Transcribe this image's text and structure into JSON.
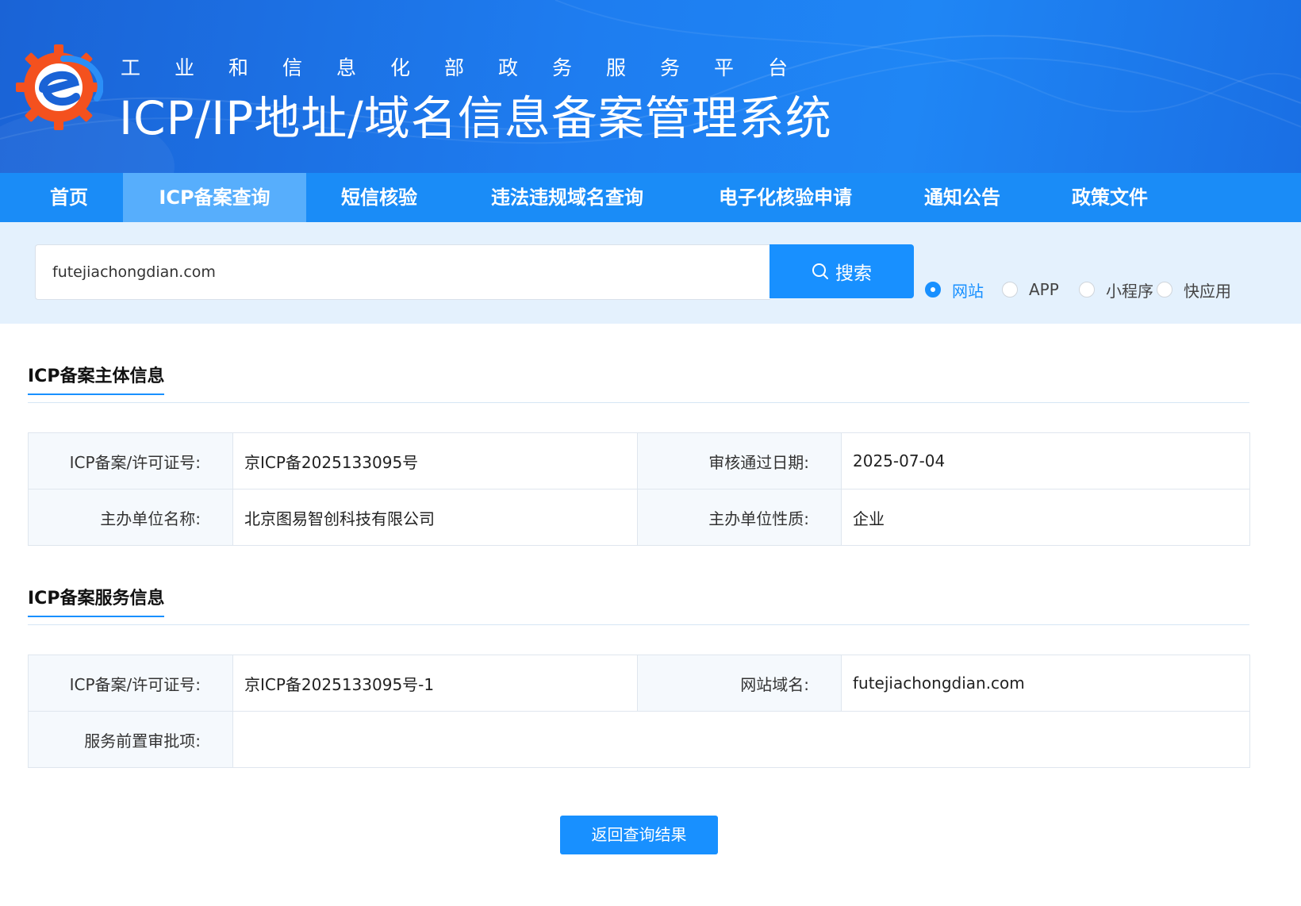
{
  "header": {
    "subtitle": "工业和信息化部政务服务平台",
    "title": "ICP/IP地址/域名信息备案管理系统"
  },
  "nav": {
    "items": [
      {
        "label": "首页"
      },
      {
        "label": "ICP备案查询",
        "active": true
      },
      {
        "label": "短信核验"
      },
      {
        "label": "违法违规域名查询"
      },
      {
        "label": "电子化核验申请"
      },
      {
        "label": "通知公告"
      },
      {
        "label": "政策文件"
      }
    ]
  },
  "search": {
    "value": "futejiachongdian.com",
    "button_label": "搜索",
    "types": [
      {
        "label": "网站",
        "checked": true
      },
      {
        "label": "APP",
        "checked": false
      },
      {
        "label": "小程序",
        "checked": false
      },
      {
        "label": "快应用",
        "checked": false
      }
    ]
  },
  "subject_info": {
    "title": "ICP备案主体信息",
    "license_label": "ICP备案/许可证号:",
    "license_value": "京ICP备2025133095号",
    "approval_date_label": "审核通过日期:",
    "approval_date_value": "2025-07-04",
    "organizer_label": "主办单位名称:",
    "organizer_value": "北京图易智创科技有限公司",
    "nature_label": "主办单位性质:",
    "nature_value": "企业"
  },
  "service_info": {
    "title": "ICP备案服务信息",
    "license_label": "ICP备案/许可证号:",
    "license_value": "京ICP备2025133095号-1",
    "domain_label": "网站域名:",
    "domain_value": "futejiachongdian.com",
    "preapproval_label": "服务前置审批项:",
    "preapproval_value": ""
  },
  "return_button": "返回查询结果",
  "colors": {
    "primary": "#1890ff",
    "nav": "#1a8cf7",
    "nav_active": "#57aefc",
    "search_strip": "#e4f1fd",
    "logo_orange": "#f4511e"
  }
}
